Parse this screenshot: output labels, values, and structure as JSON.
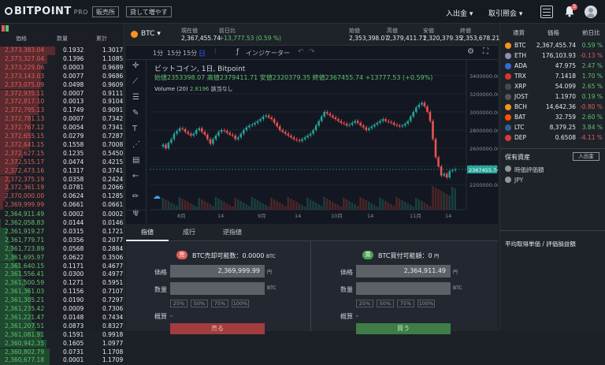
{
  "header": {
    "logo": "BITPOINT",
    "logo_suffix": "PRO",
    "nav_exchange": "販売所",
    "nav_lending": "貸して増やす",
    "menu_deposit": "入出金",
    "menu_history": "取引照会",
    "notification_badge": "3"
  },
  "orderbook": {
    "columns": [
      "価格",
      "数量",
      "累計"
    ],
    "asks": [
      [
        "2,373,383.04",
        "0.1932",
        "1.3017"
      ],
      [
        "2,373,327.04",
        "0.1396",
        "1.1085"
      ],
      [
        "2,373,229.06",
        "0.0003",
        "0.9689"
      ],
      [
        "2,373,143.03",
        "0.0077",
        "0.9686"
      ],
      [
        "2,373,075.09",
        "0.0498",
        "0.9609"
      ],
      [
        "2,372,935.11",
        "0.0007",
        "0.9111"
      ],
      [
        "2,372,817.10",
        "0.0013",
        "0.9104"
      ],
      [
        "2,372,795.13",
        "0.1749",
        "0.9091"
      ],
      [
        "2,372,781.13",
        "0.0007",
        "0.7342"
      ],
      [
        "2,372,767.12",
        "0.0054",
        "0.7341"
      ],
      [
        "2,372,655.15",
        "0.0279",
        "0.7287"
      ],
      [
        "2,372,641.15",
        "0.1558",
        "0.7008"
      ],
      [
        "2,372,627.15",
        "0.1235",
        "0.5450"
      ],
      [
        "2,372,515.17",
        "0.0474",
        "0.4215"
      ],
      [
        "2,372,473.16",
        "0.1317",
        "0.3741"
      ],
      [
        "2,372,375.19",
        "0.0358",
        "0.2424"
      ],
      [
        "2,372,361.19",
        "0.0781",
        "0.2066"
      ],
      [
        "2,370,000.00",
        "0.0624",
        "0.1285"
      ],
      [
        "2,369,999.99",
        "0.0661",
        "0.0661"
      ]
    ],
    "bids": [
      [
        "2,364,911.49",
        "0.0002",
        "0.0002"
      ],
      [
        "2,362,058.83",
        "0.0144",
        "0.0146"
      ],
      [
        "2,361,919.27",
        "0.0315",
        "0.1721"
      ],
      [
        "2,361,779.71",
        "0.0356",
        "0.2077"
      ],
      [
        "2,361,723.89",
        "0.0568",
        "0.2884"
      ],
      [
        "2,361,695.97",
        "0.0622",
        "0.3506"
      ],
      [
        "2,361,640.15",
        "0.1171",
        "0.4677"
      ],
      [
        "2,361,556.41",
        "0.0300",
        "0.4977"
      ],
      [
        "2,361,500.59",
        "0.1271",
        "0.5951"
      ],
      [
        "2,361,361.03",
        "0.1156",
        "0.7107"
      ],
      [
        "2,361,305.21",
        "0.0190",
        "0.7297"
      ],
      [
        "2,361,235.42",
        "0.0009",
        "0.7306"
      ],
      [
        "2,361,221.47",
        "0.0148",
        "0.7434"
      ],
      [
        "2,361,207.51",
        "0.0873",
        "0.8327"
      ],
      [
        "2,361,081.91",
        "0.1591",
        "0.9918"
      ],
      [
        "2,360,942.35",
        "0.1605",
        "1.0977"
      ],
      [
        "2,360,802.79",
        "0.0731",
        "1.1708"
      ],
      [
        "2,360,677.18",
        "0.0001",
        "1.1709"
      ]
    ]
  },
  "ticker": {
    "symbol": "BTC",
    "current_label": "現在値",
    "current_value": "2,367,455.74",
    "change_label": "前日比",
    "change_value": "+13,777.53 (0.59 %)",
    "open_label": "始値",
    "open_value": "2,353,398.07",
    "high_label": "高値",
    "high_value": "2,379,411.71",
    "low_label": "安値",
    "low_value": "2,320,379.35",
    "close_label": "終値",
    "close_value": "2,353,678.21"
  },
  "chart_toolbar": {
    "tf1": "1分",
    "tf2": "15分",
    "tf3": "15分",
    "indicator": "インジケーター"
  },
  "chart_data": {
    "type": "candlestick",
    "legend_title": "ビットコイン, 1日, Bitpoint",
    "ohlc_line": "始値2353398.07 高値2379411.71 安値2320379.35 終値2367455.74 +13777.53 (+0.59%)",
    "volume_label": "Volume (20)",
    "volume_value": "2.8196",
    "volume_suffix": "該当なし",
    "last_price_tag": "2367455.74",
    "y_ticks": [
      "3400000.00",
      "3200000.00",
      "3000000.00",
      "2800000.00",
      "2600000.00",
      "2400000.00",
      "2200000.00"
    ],
    "x_ticks": [
      "8月",
      "14",
      "9月",
      "14",
      "10月",
      "14",
      "11月",
      "14"
    ],
    "ylim": [
      2150000,
      3450000
    ]
  },
  "order_tabs": {
    "tab1": "指値",
    "tab2": "成行",
    "tab3": "逆指値"
  },
  "sell_form": {
    "badge": "売",
    "available_label": "BTC売却可能数：0.0000",
    "available_unit": "BTC",
    "price_label": "価格",
    "price_value": "2,369,999.99",
    "price_unit": "円",
    "qty_label": "数量",
    "qty_unit": "BTC",
    "pcts": [
      "25%",
      "50%",
      "75%",
      "100%"
    ],
    "approx_label": "概算",
    "approx_value": "-",
    "submit": "売る"
  },
  "buy_form": {
    "badge": "買",
    "available_label": "BTC買付可能額：0",
    "available_unit": "円",
    "price_label": "価格",
    "price_value": "2,364,911.49",
    "price_unit": "円",
    "qty_label": "数量",
    "qty_unit": "BTC",
    "pcts": [
      "25%",
      "50%",
      "75%",
      "100%"
    ],
    "approx_label": "概算",
    "approx_value": "-",
    "submit": "買う"
  },
  "market": {
    "columns": [
      "通貨",
      "価格",
      "前日比"
    ],
    "rows": [
      {
        "name": "BTC",
        "price": "2,367,455.74",
        "change": "0.59 %",
        "up": true,
        "color": "#f7931a"
      },
      {
        "name": "ETH",
        "price": "176,103.93",
        "change": "-0.13 %",
        "up": false,
        "color": "#8a92b2"
      },
      {
        "name": "ADA",
        "price": "47.975",
        "change": "2.47 %",
        "up": true,
        "color": "#2f6fd8"
      },
      {
        "name": "TRX",
        "price": "7.1418",
        "change": "1.70 %",
        "up": true,
        "color": "#d9342b"
      },
      {
        "name": "XRP",
        "price": "54.099",
        "change": "2.65 %",
        "up": true,
        "color": "#444a52"
      },
      {
        "name": "JOST",
        "price": "1.1970",
        "change": "0.19 %",
        "up": true,
        "color": "#555"
      },
      {
        "name": "BCH",
        "price": "14,642.36",
        "change": "-0.80 %",
        "up": false,
        "color": "#f7931a"
      },
      {
        "name": "BAT",
        "price": "32.759",
        "change": "2.60 %",
        "up": true,
        "color": "#ff5000"
      },
      {
        "name": "LTC",
        "price": "8,379.25",
        "change": "3.84 %",
        "up": true,
        "color": "#345d9d"
      },
      {
        "name": "DEP",
        "price": "0.6508",
        "change": "-4.11 %",
        "up": false,
        "color": "#d63a3a"
      }
    ],
    "assets_title": "保有資産",
    "assets_button": "入出金",
    "assets_rows": [
      "時価評価額",
      "JPY"
    ],
    "avg_title": "平均取得単価 / 評価損益額"
  },
  "colors": {
    "up": "#5fc26a",
    "down": "#e25c5c",
    "ask_bar": "#5a2a2e",
    "bid_bar": "#1f4a30"
  }
}
